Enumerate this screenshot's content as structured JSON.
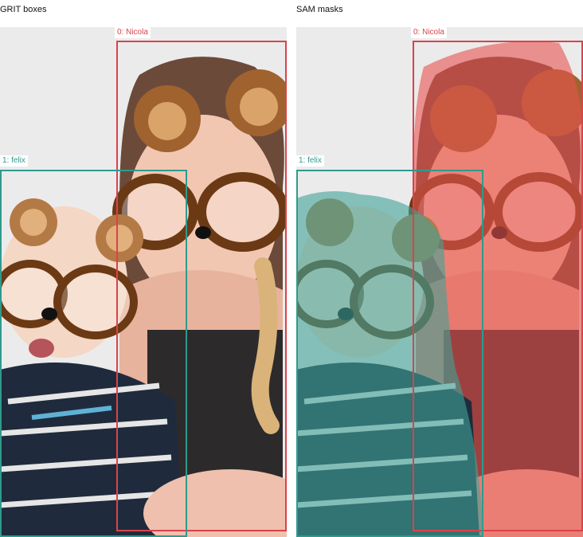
{
  "panels": [
    {
      "title": "GRIT boxes"
    },
    {
      "title": "SAM masks"
    }
  ],
  "detections": [
    {
      "label": "0: Nicola",
      "color": "#d9434b"
    },
    {
      "label": "1: felix",
      "color": "#2f9a8d"
    }
  ]
}
